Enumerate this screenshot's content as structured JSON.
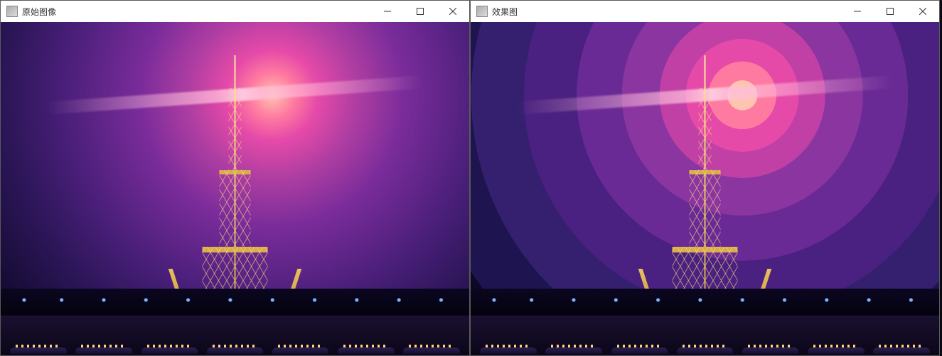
{
  "windows": [
    {
      "icon": "image-app-icon",
      "title": "原始图像"
    },
    {
      "icon": "image-app-icon",
      "title": "效果图"
    }
  ],
  "controls": {
    "minimize": "Minimize",
    "maximize": "Maximize",
    "close": "Close"
  }
}
